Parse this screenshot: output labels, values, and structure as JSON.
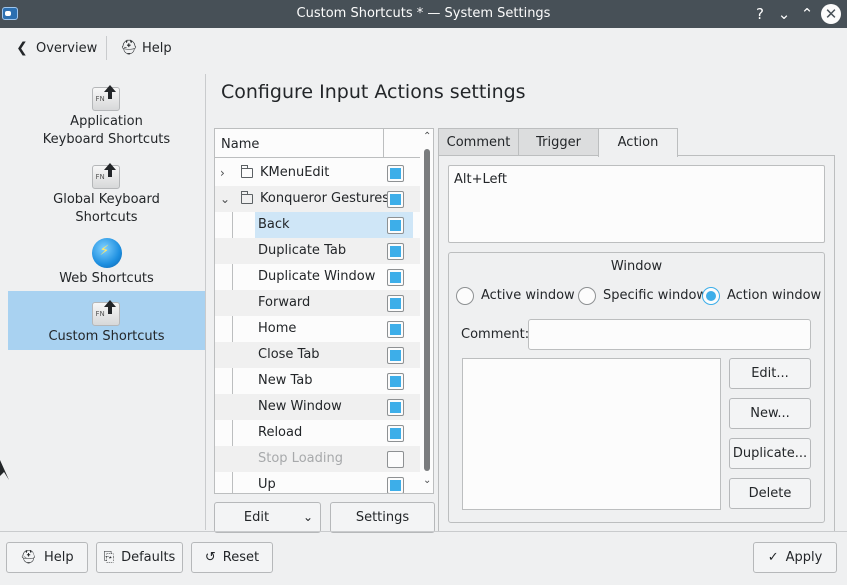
{
  "window": {
    "title": "Custom Shortcuts * — System Settings",
    "controls": {
      "help": "?",
      "minimize": "⌄",
      "maximize": "⌃",
      "close": "✕"
    }
  },
  "toolbar": {
    "overview": "Overview",
    "help": "Help"
  },
  "sidebar": {
    "items": [
      {
        "label": "Application Keyboard Shortcuts",
        "icon": "keyboard-shortcuts-icon"
      },
      {
        "label": "Global Keyboard Shortcuts",
        "icon": "keyboard-shortcuts-icon"
      },
      {
        "label": "Web Shortcuts",
        "icon": "globe-icon"
      },
      {
        "label": "Custom Shortcuts",
        "icon": "keyboard-shortcuts-icon",
        "selected": true
      }
    ]
  },
  "main": {
    "heading": "Configure Input Actions settings",
    "tree": {
      "header": "Name",
      "groups": [
        {
          "label": "KMenuEdit",
          "expanded": false,
          "enabled": true
        },
        {
          "label": "Konqueror Gestures",
          "expanded": true,
          "enabled": true
        }
      ],
      "items": [
        {
          "label": "Back",
          "enabled": true,
          "selected": true
        },
        {
          "label": "Duplicate Tab",
          "enabled": true
        },
        {
          "label": "Duplicate Window",
          "enabled": true
        },
        {
          "label": "Forward",
          "enabled": true
        },
        {
          "label": "Home",
          "enabled": true
        },
        {
          "label": "Close Tab",
          "enabled": true
        },
        {
          "label": "New Tab",
          "enabled": true
        },
        {
          "label": "New Window",
          "enabled": true
        },
        {
          "label": "Reload",
          "enabled": true
        },
        {
          "label": "Stop Loading",
          "enabled": false
        },
        {
          "label": "Up",
          "enabled": true
        }
      ]
    },
    "edit_button": "Edit",
    "settings_button": "Settings",
    "tabs": [
      "Comment",
      "Trigger",
      "Action"
    ],
    "active_tab": "Action",
    "action": {
      "shortcut": "Alt+Left",
      "window_group_title": "Window",
      "radios": [
        "Active window",
        "Specific window",
        "Action window"
      ],
      "selected_radio": "Action window",
      "comment_label": "Comment:",
      "comment_value": "",
      "buttons": [
        "Edit...",
        "New...",
        "Duplicate...",
        "Delete"
      ]
    }
  },
  "footer": {
    "help": "Help",
    "defaults": "Defaults",
    "reset": "Reset",
    "apply": "Apply"
  },
  "colors": {
    "accent": "#3daee9",
    "selection": "#a9d2f1",
    "titlebar": "#475057"
  }
}
